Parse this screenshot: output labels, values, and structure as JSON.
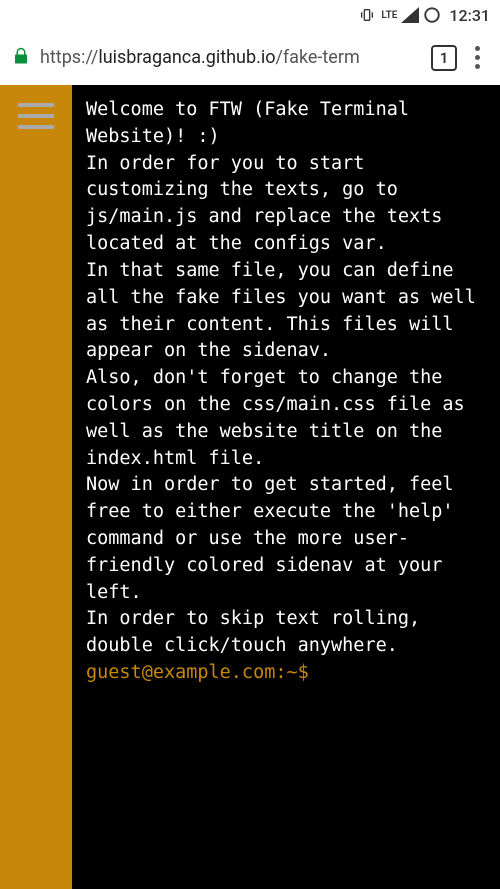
{
  "status_bar": {
    "lte_label": "LTE",
    "time": "12:31"
  },
  "browser": {
    "url_prefix": "https://",
    "url_host": "luisbraganca.github.io",
    "url_path": "/fake-term",
    "tab_count": "1"
  },
  "terminal": {
    "lines": [
      "Welcome to FTW (Fake Terminal Website)! :)",
      "In order for you to start customizing the texts, go to js/main.js and replace the texts located at the configs var.",
      "In that same file, you can define all the fake files you want as well as their content. This files will appear on the sidenav.",
      "Also, don't forget to change the colors on the css/main.css file as well as the website title on the index.html file.",
      "Now in order to get started, feel free to either execute the 'help' command or use the more user-friendly colored sidenav at your left.",
      "In order to skip text rolling, double click/touch anywhere."
    ],
    "prompt": "guest@example.com:~$ "
  }
}
